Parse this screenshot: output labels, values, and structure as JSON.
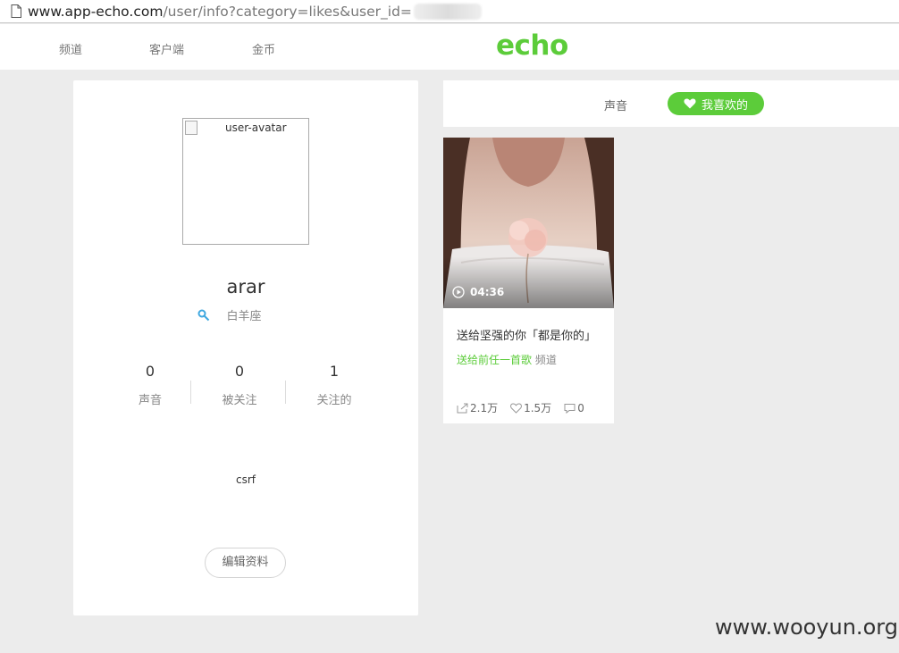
{
  "address_bar": {
    "url_host": "www.app-echo.com",
    "url_rest": "/user/info?category=likes&user_id="
  },
  "nav": {
    "items": [
      "频道",
      "客户端",
      "金币"
    ],
    "logo": "echo"
  },
  "profile": {
    "avatar_alt": "user-avatar",
    "username": "arar",
    "zodiac": "白羊座",
    "stats": [
      {
        "value": "0",
        "label": "声音"
      },
      {
        "value": "0",
        "label": "被关注"
      },
      {
        "value": "1",
        "label": "关注的"
      }
    ],
    "bio": "csrf",
    "edit_label": "编辑资料"
  },
  "tabs": {
    "sound_label": "声音",
    "likes_label": "我喜欢的"
  },
  "sound_card": {
    "duration": "04:36",
    "title": "送给坚强的你「都是你的」",
    "channel_name": "送给前任一首歌",
    "channel_suffix": "频道",
    "shares": "2.1万",
    "likes": "1.5万",
    "comments": "0"
  },
  "watermark": "www.wooyun.org",
  "colors": {
    "accent": "#5ccc3a",
    "background": "#ececec"
  }
}
